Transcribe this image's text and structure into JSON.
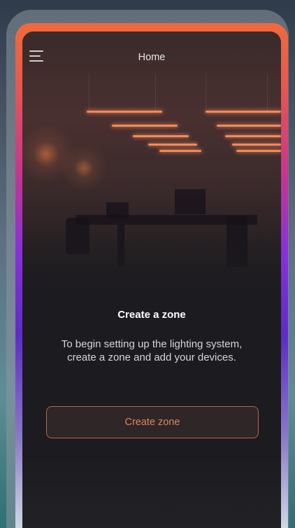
{
  "header": {
    "title": "Home"
  },
  "empty_state": {
    "heading": "Create a zone",
    "message_line1": "To begin setting up the lighting system,",
    "message_line2": "create a zone and add your devices."
  },
  "actions": {
    "create_zone_label": "Create zone"
  },
  "icons": {
    "menu": "hamburger-menu-icon"
  },
  "colors": {
    "accent": "#e0845f",
    "accent_border": "#b8664a",
    "background": "#1c1b1f",
    "text_primary": "#ffffff",
    "text_secondary": "#d6d6d6"
  }
}
